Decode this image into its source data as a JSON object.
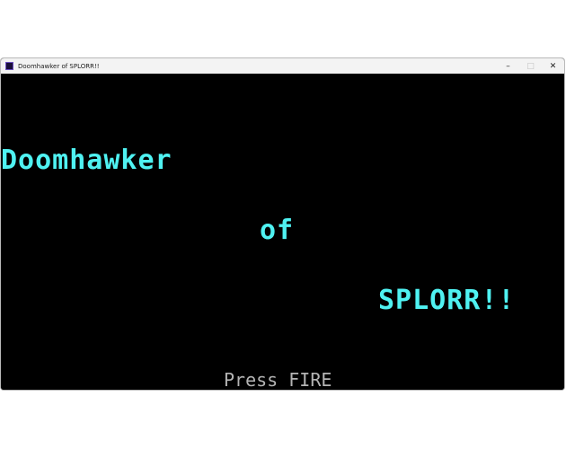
{
  "window": {
    "title": "Doomhawker of SPLORR!!",
    "controls": {
      "minimize": "–",
      "maximize": "□",
      "close": "✕"
    }
  },
  "game": {
    "title_lines": [
      "Doomhawker",
      "of",
      "SPLORR!!"
    ],
    "prompt": "Press FIRE",
    "colors": {
      "background": "#000000",
      "title": "#4ff2f2",
      "prompt": "#b4b4b4"
    }
  }
}
